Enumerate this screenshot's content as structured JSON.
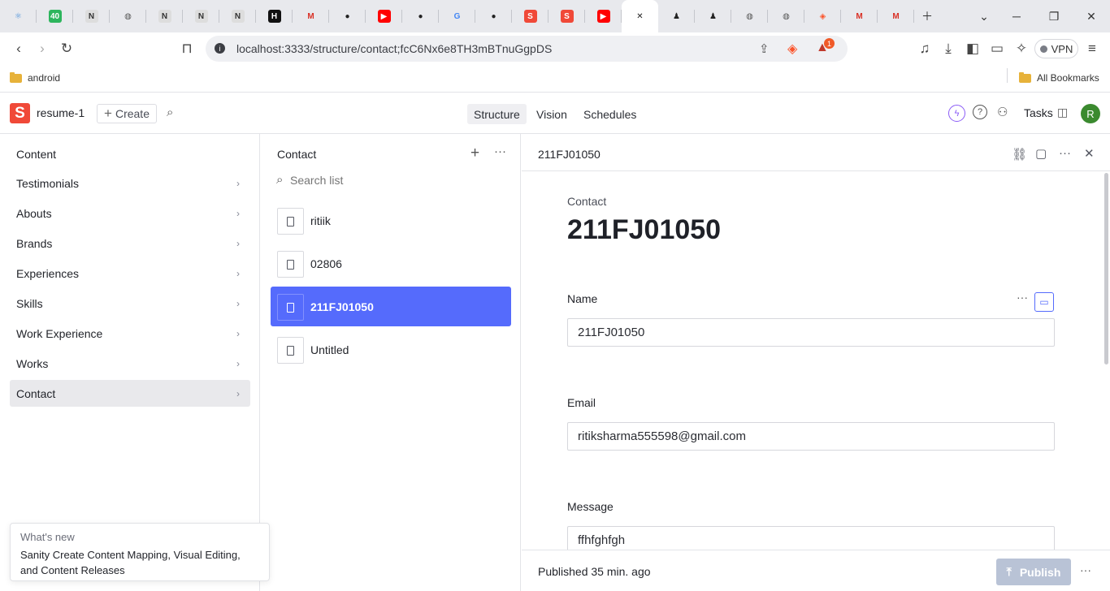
{
  "browser": {
    "tabs": [
      {
        "icon": "react-icon",
        "glyph": "⚛",
        "color": "#4a90d9",
        "bg": "transparent"
      },
      {
        "icon": "badge-40-icon",
        "glyph": "40",
        "color": "#fff",
        "bg": "#2db55d"
      },
      {
        "icon": "next-icon",
        "glyph": "N",
        "color": "#333",
        "bg": "#ddd"
      },
      {
        "icon": "globe-icon",
        "glyph": "◍",
        "color": "#555",
        "bg": "transparent"
      },
      {
        "icon": "next-icon",
        "glyph": "N",
        "color": "#333",
        "bg": "#ddd"
      },
      {
        "icon": "next-icon",
        "glyph": "N",
        "color": "#333",
        "bg": "#ddd"
      },
      {
        "icon": "next-icon",
        "glyph": "N",
        "color": "#333",
        "bg": "#ddd"
      },
      {
        "icon": "hashnode-icon",
        "glyph": "H",
        "color": "#fff",
        "bg": "#111"
      },
      {
        "icon": "gmail-icon",
        "glyph": "M",
        "color": "#d93025",
        "bg": "transparent"
      },
      {
        "icon": "github-icon",
        "glyph": "●",
        "color": "#222",
        "bg": "transparent"
      },
      {
        "icon": "youtube-icon",
        "glyph": "▶",
        "color": "#fff",
        "bg": "#f00"
      },
      {
        "icon": "github-icon",
        "glyph": "●",
        "color": "#222",
        "bg": "transparent"
      },
      {
        "icon": "google-icon",
        "glyph": "G",
        "color": "#4285f4",
        "bg": "transparent"
      },
      {
        "icon": "github-icon",
        "glyph": "●",
        "color": "#222",
        "bg": "transparent"
      },
      {
        "icon": "sanity-icon",
        "glyph": "S",
        "color": "#fff",
        "bg": "#f04938"
      },
      {
        "icon": "sanity-icon",
        "glyph": "S",
        "color": "#fff",
        "bg": "#f04938"
      },
      {
        "icon": "youtube-icon",
        "glyph": "▶",
        "color": "#fff",
        "bg": "#f00"
      },
      {
        "icon": "close-icon",
        "glyph": "✕",
        "color": "#222",
        "bg": "transparent",
        "active": true
      },
      {
        "icon": "person-icon",
        "glyph": "♟",
        "color": "#222",
        "bg": "transparent"
      },
      {
        "icon": "person-icon",
        "glyph": "♟",
        "color": "#222",
        "bg": "transparent"
      },
      {
        "icon": "globe-icon",
        "glyph": "◍",
        "color": "#555",
        "bg": "transparent"
      },
      {
        "icon": "globe-icon",
        "glyph": "◍",
        "color": "#555",
        "bg": "transparent"
      },
      {
        "icon": "brave-icon",
        "glyph": "◈",
        "color": "#fb542b",
        "bg": "transparent"
      },
      {
        "icon": "gmail-icon",
        "glyph": "M",
        "color": "#d93025",
        "bg": "transparent"
      },
      {
        "icon": "gmail-icon",
        "glyph": "M",
        "color": "#d93025",
        "bg": "transparent"
      }
    ],
    "url": "localhost:3333/structure/contact;fcC6Nx6e8TH3mBTnuGgpDS",
    "bookmarks": {
      "left": "android",
      "right": "All Bookmarks"
    },
    "vpn_label": "VPN",
    "brave_badge": "1"
  },
  "app": {
    "project": "resume-1",
    "create_label": "Create",
    "logo_letter": "S",
    "nav_tabs": [
      "Structure",
      "Vision",
      "Schedules"
    ],
    "tasks_label": "Tasks",
    "avatar_letter": "R"
  },
  "content_pane": {
    "title": "Content",
    "items": [
      "Testimonials",
      "Abouts",
      "Brands",
      "Experiences",
      "Skills",
      "Work Experience",
      "Works",
      "Contact"
    ]
  },
  "list_pane": {
    "title": "Contact",
    "search_placeholder": "Search list",
    "docs": [
      "ritiik",
      "02806",
      "211FJ01050",
      "Untitled"
    ]
  },
  "editor": {
    "header_title": "211FJ01050",
    "doc_type": "Contact",
    "doc_title": "211FJ01050",
    "fields": [
      {
        "label": "Name",
        "value": "211FJ01050"
      },
      {
        "label": "Email",
        "value": "ritiksharma555598@gmail.com"
      },
      {
        "label": "Message",
        "value": "ffhfghfgh"
      }
    ],
    "status": "Published 35 min. ago",
    "publish_label": "Publish"
  },
  "toast": {
    "heading": "What's new",
    "body": "Sanity Create Content Mapping, Visual Editing, and Content Releases"
  },
  "colors": {
    "accent": "#556bfc",
    "brand": "#f04938",
    "publish_disabled": "#b9c3d6"
  }
}
